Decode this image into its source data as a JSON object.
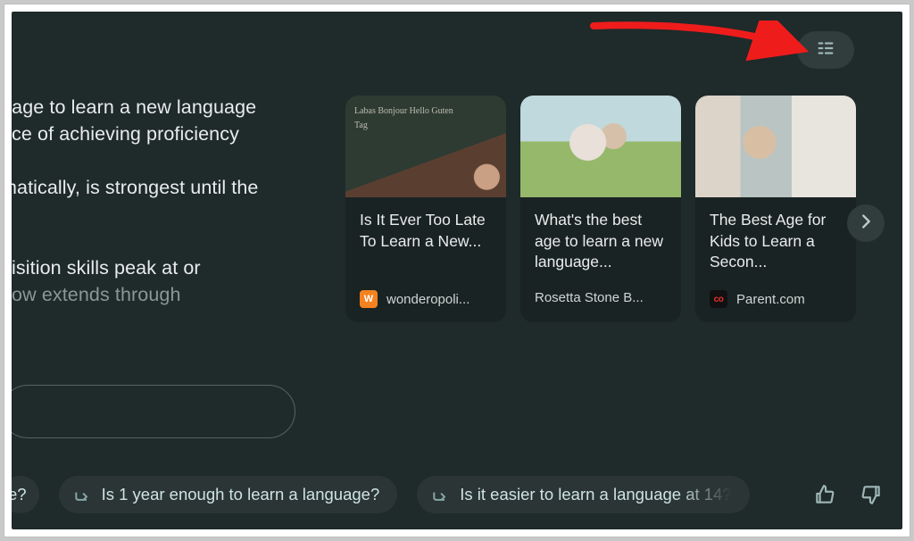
{
  "left_text": {
    "line1": "t age to learn a new language",
    "line2": "nce of achieving proficiency",
    "line3": "matically, is strongest until the",
    "line4": ".",
    "line5": "uisition skills peak at or",
    "line6": "dow extends through"
  },
  "cards": [
    {
      "title": "Is It Ever Too Late To Learn a New...",
      "source": "wonderopoli...",
      "favicon_letter": "W",
      "favicon_class": "fav-orange",
      "thumb_class": "thumb-1"
    },
    {
      "title": "What's the best age to learn a new language...",
      "source": "Rosetta Stone B...",
      "favicon_letter": "",
      "favicon_class": "",
      "thumb_class": "thumb-2"
    },
    {
      "title": "The Best Age for Kids to Learn a Secon...",
      "source": "Parent.com",
      "favicon_letter": "co",
      "favicon_class": "fav-red",
      "thumb_class": "thumb-3"
    }
  ],
  "chips": {
    "truncated_label": "e?",
    "chip1": "Is 1 year enough to learn a language?",
    "chip2": "Is it easier to learn a language at 14?"
  },
  "icons": {
    "sources_panel": "sources-panel-icon",
    "next": "chevron-right-icon",
    "reply": "reply-arrow-icon",
    "thumbs_up": "thumbs-up-icon",
    "thumbs_down": "thumbs-down-icon"
  },
  "colors": {
    "bg": "#1f2a2a",
    "card_bg": "#1a2323",
    "chip_bg": "#2b3535",
    "accent": "#9fb6b6",
    "annotation_arrow": "#ef1c1c"
  }
}
